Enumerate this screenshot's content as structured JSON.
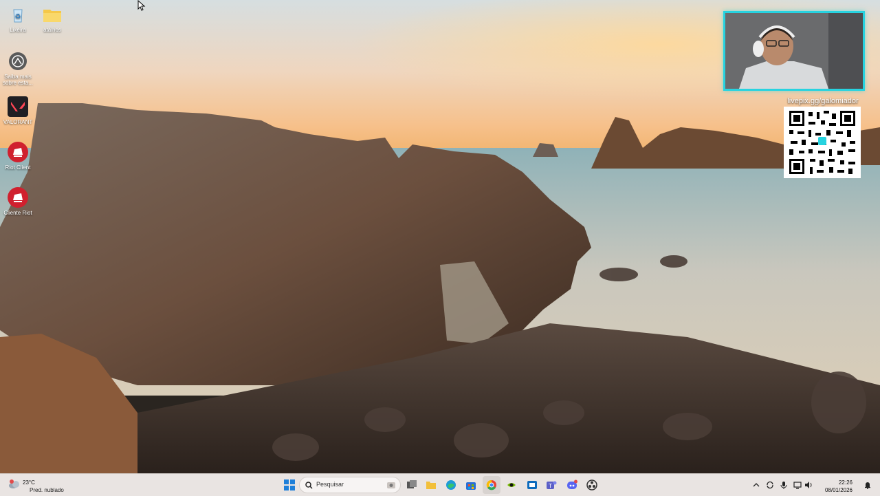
{
  "desktop": {
    "icons": [
      {
        "label": "Lixeira",
        "icon": "recycle-bin-icon"
      },
      {
        "label": "atalhos",
        "icon": "folder-icon"
      },
      {
        "label": "Saiba mais sobre esta...",
        "icon": "camera-info-icon"
      },
      {
        "label": "VALORANT",
        "icon": "valorant-icon"
      },
      {
        "label": "Riot Client",
        "icon": "riot-client-icon"
      },
      {
        "label": "Cliente Riot",
        "icon": "riot-client-icon"
      }
    ]
  },
  "overlay": {
    "url": "livepix.gg/galomiador"
  },
  "taskbar": {
    "weather": {
      "temp": "23°C",
      "condition": "Pred. nublado"
    },
    "search_label": "Pesquisar",
    "apps": [
      "start-icon",
      "search-icon",
      "task-view-icon",
      "file-explorer-icon",
      "edge-icon",
      "store-icon",
      "chrome-icon",
      "nvidia-icon",
      "outlook-icon",
      "teams-icon",
      "discord-icon",
      "obs-icon"
    ],
    "tray": {
      "time": "22:26",
      "date": "08/01/2026"
    }
  },
  "colors": {
    "accent": "#27d3e0",
    "taskbar": "#e9e4e2"
  }
}
